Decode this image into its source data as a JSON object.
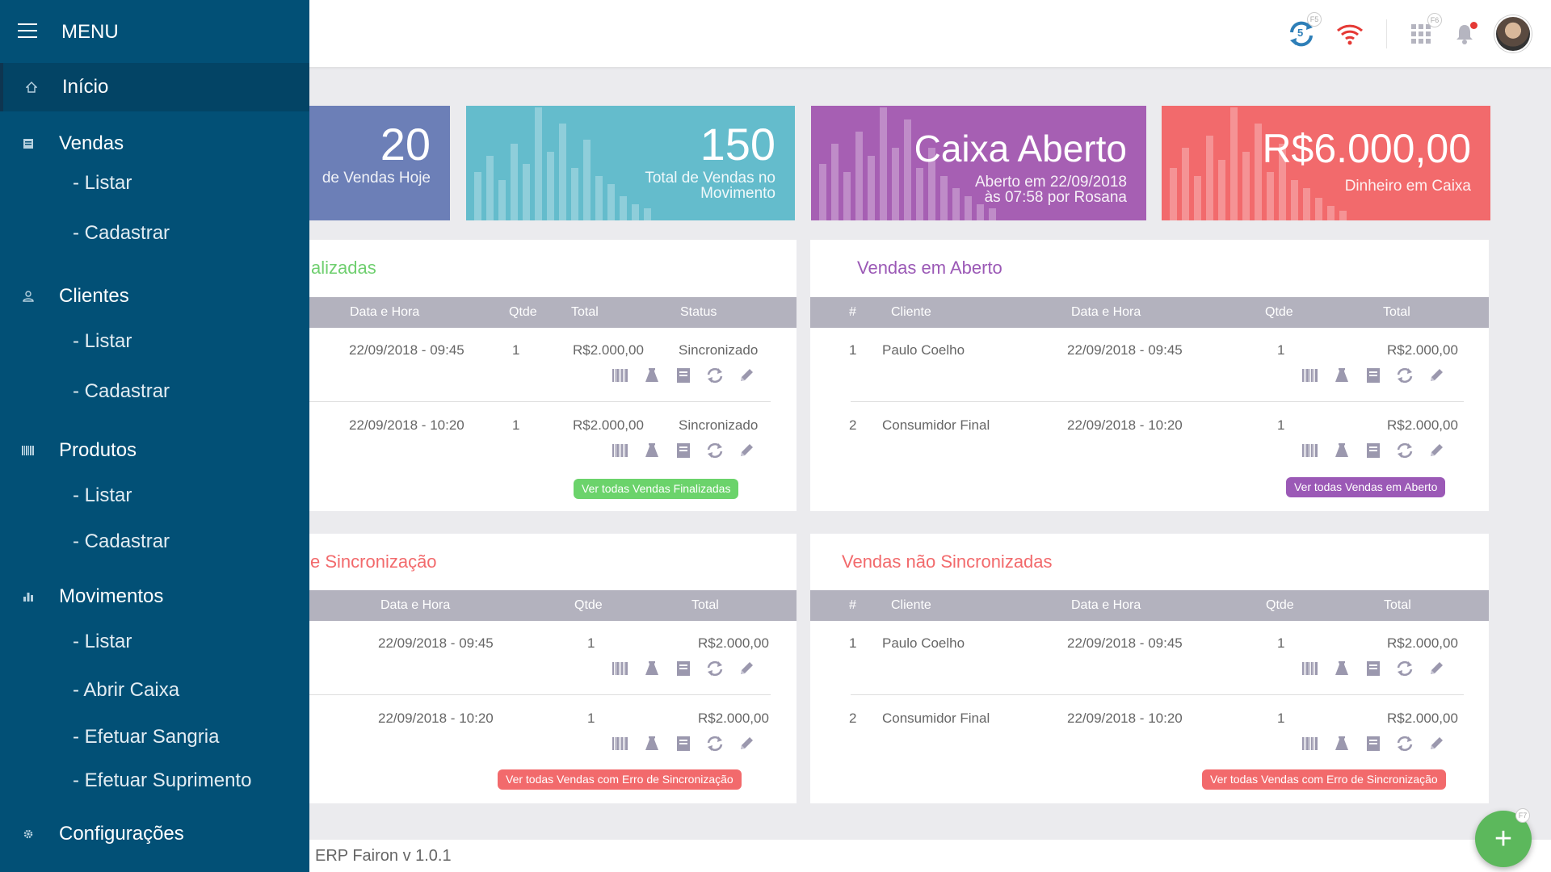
{
  "topbar": {
    "sync_count": "5",
    "sync_key": "F5",
    "apps_key": "F6"
  },
  "stats": [
    {
      "value": "20",
      "label": "de Vendas Hoje",
      "color": "#6c7fb7"
    },
    {
      "value": "150",
      "label_line1": "Total de Vendas no",
      "label_line2": "Movimento",
      "color": "#64bccc"
    },
    {
      "value": "Caixa Aberto",
      "label_line1": "Aberto em 22/09/2018",
      "label_line2": "às 07:58 por Rosana",
      "color": "#a65fb3"
    },
    {
      "value": "R$6.000,00",
      "label": "Dinheiro em Caixa",
      "color": "#f26a6c"
    }
  ],
  "panel_finalizadas": {
    "title": "alizadas",
    "title_color": "#6fcf6f",
    "headers": [
      "Data e Hora",
      "Qtde",
      "Total",
      "Status"
    ],
    "rows": [
      {
        "date": "22/09/2018 - 09:45",
        "qtde": "1",
        "total": "R$2.000,00",
        "status": "Sincronizado"
      },
      {
        "date": "22/09/2018 - 10:20",
        "qtde": "1",
        "total": "R$2.000,00",
        "status": "Sincronizado"
      }
    ],
    "button": "Ver todas Vendas Finalizadas",
    "button_color": "#6bd36b"
  },
  "panel_aberto": {
    "title": "Vendas em Aberto",
    "title_color": "#9b59b6",
    "headers": [
      "#",
      "Cliente",
      "Data e Hora",
      "Qtde",
      "Total"
    ],
    "rows": [
      {
        "num": "1",
        "cliente": "Paulo Coelho",
        "date": "22/09/2018 - 09:45",
        "qtde": "1",
        "total": "R$2.000,00"
      },
      {
        "num": "2",
        "cliente": "Consumidor Final",
        "date": "22/09/2018 - 10:20",
        "qtde": "1",
        "total": "R$2.000,00"
      }
    ],
    "button": "Ver todas Vendas em Aberto",
    "button_color": "#9b59b6"
  },
  "panel_erro": {
    "title": "e Sincronização",
    "title_color": "#f26a6c",
    "headers": [
      "Data e Hora",
      "Qtde",
      "Total"
    ],
    "rows": [
      {
        "date": "22/09/2018 - 09:45",
        "qtde": "1",
        "total": "R$2.000,00"
      },
      {
        "date": "22/09/2018 - 10:20",
        "qtde": "1",
        "total": "R$2.000,00"
      }
    ],
    "button": "Ver todas Vendas com Erro de Sincronização",
    "button_color": "#f26a6c"
  },
  "panel_nao_sinc": {
    "title": "Vendas não Sincronizadas",
    "title_color": "#f26a6c",
    "headers": [
      "#",
      "Cliente",
      "Data e Hora",
      "Qtde",
      "Total"
    ],
    "rows": [
      {
        "num": "1",
        "cliente": "Paulo Coelho",
        "date": "22/09/2018 - 09:45",
        "qtde": "1",
        "total": "R$2.000,00"
      },
      {
        "num": "2",
        "cliente": "Consumidor Final",
        "date": "22/09/2018 - 10:20",
        "qtde": "1",
        "total": "R$2.000,00"
      }
    ],
    "button": "Ver todas Vendas com Erro de Sincronização",
    "button_color": "#f26a6c"
  },
  "sidebar": {
    "menu_label": "MENU",
    "items": [
      {
        "label": "Início",
        "icon": "home-icon"
      },
      {
        "label": "Vendas",
        "icon": "receipt-icon",
        "subs": [
          "- Listar",
          "- Cadastrar"
        ]
      },
      {
        "label": "Clientes",
        "icon": "person-icon",
        "subs": [
          "- Listar",
          "- Cadastrar"
        ]
      },
      {
        "label": "Produtos",
        "icon": "barcode-icon",
        "subs": [
          "- Listar",
          "- Cadastrar"
        ]
      },
      {
        "label": "Movimentos",
        "icon": "bar-chart-icon",
        "subs": [
          "- Listar",
          "- Abrir Caixa",
          "- Efetuar Sangria",
          "- Efetuar Suprimento"
        ]
      },
      {
        "label": "Configurações",
        "icon": "gear-icon"
      }
    ]
  },
  "footer": {
    "text": "ERP Fairon v 1.0.1"
  },
  "fab": {
    "label": "+",
    "key": "F7"
  },
  "row_actions": [
    "barcode-icon",
    "bag-icon",
    "receipt-icon",
    "sync-icon",
    "pencil-icon"
  ]
}
